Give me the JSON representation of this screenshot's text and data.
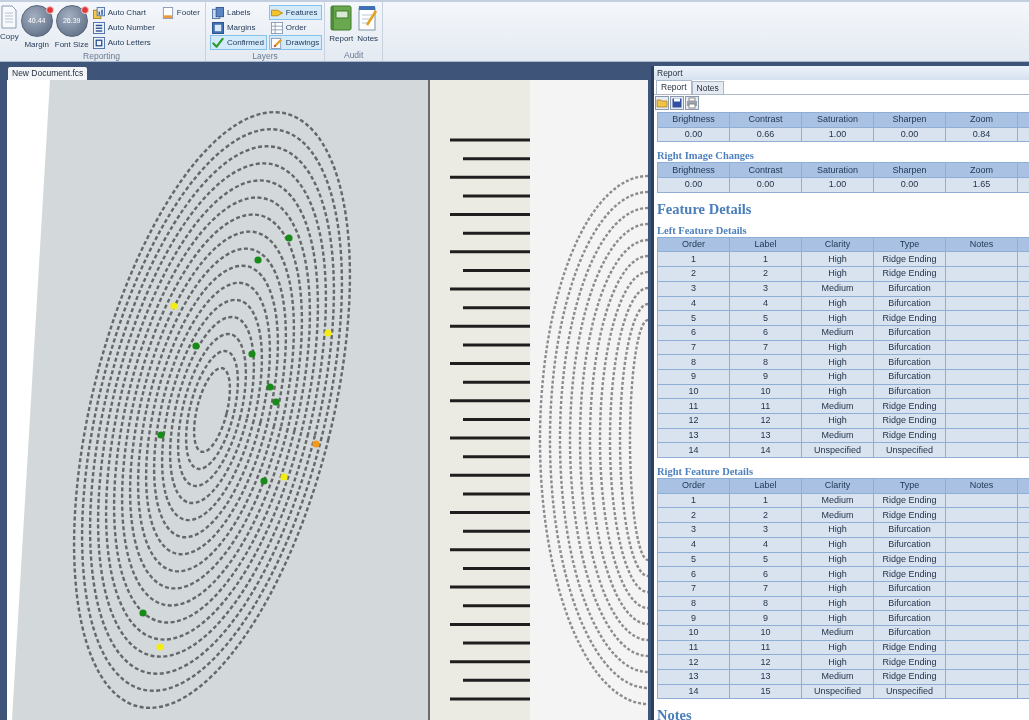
{
  "ribbon": {
    "groups": [
      {
        "label": "Reporting",
        "items": [
          {
            "kind": "large",
            "label": "Copy"
          },
          {
            "kind": "dial",
            "label": "Margin",
            "value": "40.44"
          },
          {
            "kind": "dial",
            "label": "Font Size",
            "value": "26.39"
          },
          {
            "kind": "small",
            "label": "Auto Chart"
          },
          {
            "kind": "small",
            "label": "Auto Number"
          },
          {
            "kind": "small",
            "label": "Auto Letters"
          },
          {
            "kind": "small",
            "label": "Footer"
          }
        ]
      },
      {
        "label": "Layers",
        "items": [
          {
            "kind": "small",
            "label": "Labels",
            "on": false
          },
          {
            "kind": "small",
            "label": "Margins",
            "on": false
          },
          {
            "kind": "small",
            "label": "Confirmed",
            "on": true
          },
          {
            "kind": "small",
            "label": "Features",
            "on": true
          },
          {
            "kind": "small",
            "label": "Order",
            "on": false
          },
          {
            "kind": "small",
            "label": "Drawings",
            "on": true
          }
        ]
      },
      {
        "label": "Audit",
        "items": [
          {
            "kind": "large",
            "label": "Report"
          },
          {
            "kind": "large",
            "label": "Notes"
          }
        ]
      }
    ]
  },
  "document": {
    "tab": "New Document.fcs",
    "markers": [
      {
        "color": "#178a17"
      },
      {
        "color": "#178a17"
      },
      {
        "color": "#f2ec12"
      },
      {
        "color": "#f2ec12"
      },
      {
        "color": "#178a17"
      },
      {
        "color": "#178a17"
      },
      {
        "color": "#178a17"
      },
      {
        "color": "#178a17"
      },
      {
        "color": "#178a17"
      },
      {
        "color": "#f39a1b"
      },
      {
        "color": "#f2ec12"
      },
      {
        "color": "#178a17"
      },
      {
        "color": "#178a17"
      },
      {
        "color": "#f2ec12"
      }
    ]
  },
  "report": {
    "title": "Report",
    "tabs": [
      {
        "label": "Report",
        "selected": true
      },
      {
        "label": "Notes",
        "selected": false
      }
    ],
    "blocks": [
      {
        "kind": "table",
        "columns": [
          "Brightness",
          "Contrast",
          "Saturation",
          "Sharpen",
          "Zoom"
        ],
        "rows": [
          [
            "0.00",
            "0.66",
            "1.00",
            "0.00",
            "0.84"
          ]
        ]
      },
      {
        "kind": "subheading",
        "text": "Right Image Changes"
      },
      {
        "kind": "table",
        "columns": [
          "Brightness",
          "Contrast",
          "Saturation",
          "Sharpen",
          "Zoom"
        ],
        "rows": [
          [
            "0.00",
            "0.00",
            "1.00",
            "0.00",
            "1.65"
          ]
        ]
      },
      {
        "kind": "heading",
        "text": "Feature Details"
      },
      {
        "kind": "subheading",
        "text": "Left Feature Details"
      },
      {
        "kind": "table",
        "columns": [
          "Order",
          "Label",
          "Clarity",
          "Type",
          "Notes"
        ],
        "rows": [
          [
            "1",
            "1",
            "High",
            "Ridge Ending"
          ],
          [
            "2",
            "2",
            "High",
            "Ridge Ending"
          ],
          [
            "3",
            "3",
            "Medium",
            "Bifurcation"
          ],
          [
            "4",
            "4",
            "High",
            "Bifurcation"
          ],
          [
            "5",
            "5",
            "High",
            "Ridge Ending"
          ],
          [
            "6",
            "6",
            "Medium",
            "Bifurcation"
          ],
          [
            "7",
            "7",
            "High",
            "Bifurcation"
          ],
          [
            "8",
            "8",
            "High",
            "Bifurcation"
          ],
          [
            "9",
            "9",
            "High",
            "Bifurcation"
          ],
          [
            "10",
            "10",
            "High",
            "Bifurcation"
          ],
          [
            "11",
            "11",
            "Medium",
            "Ridge Ending"
          ],
          [
            "12",
            "12",
            "High",
            "Ridge Ending"
          ],
          [
            "13",
            "13",
            "Medium",
            "Ridge Ending"
          ],
          [
            "14",
            "14",
            "Unspecified",
            "Unspecified"
          ]
        ]
      },
      {
        "kind": "subheading",
        "text": "Right Feature Details"
      },
      {
        "kind": "table",
        "columns": [
          "Order",
          "Label",
          "Clarity",
          "Type",
          "Notes"
        ],
        "rows": [
          [
            "1",
            "1",
            "Medium",
            "Ridge Ending"
          ],
          [
            "2",
            "2",
            "Medium",
            "Ridge Ending"
          ],
          [
            "3",
            "3",
            "High",
            "Bifurcation"
          ],
          [
            "4",
            "4",
            "High",
            "Bifurcation"
          ],
          [
            "5",
            "5",
            "High",
            "Ridge Ending"
          ],
          [
            "6",
            "6",
            "High",
            "Ridge Ending"
          ],
          [
            "7",
            "7",
            "High",
            "Bifurcation"
          ],
          [
            "8",
            "8",
            "High",
            "Bifurcation"
          ],
          [
            "9",
            "9",
            "High",
            "Bifurcation"
          ],
          [
            "10",
            "10",
            "Medium",
            "Bifurcation"
          ],
          [
            "11",
            "11",
            "High",
            "Ridge Ending"
          ],
          [
            "12",
            "12",
            "High",
            "Ridge Ending"
          ],
          [
            "13",
            "13",
            "Medium",
            "Ridge Ending"
          ],
          [
            "14",
            "15",
            "Unspecified",
            "Unspecified"
          ]
        ]
      },
      {
        "kind": "heading",
        "text": "Notes"
      }
    ]
  }
}
